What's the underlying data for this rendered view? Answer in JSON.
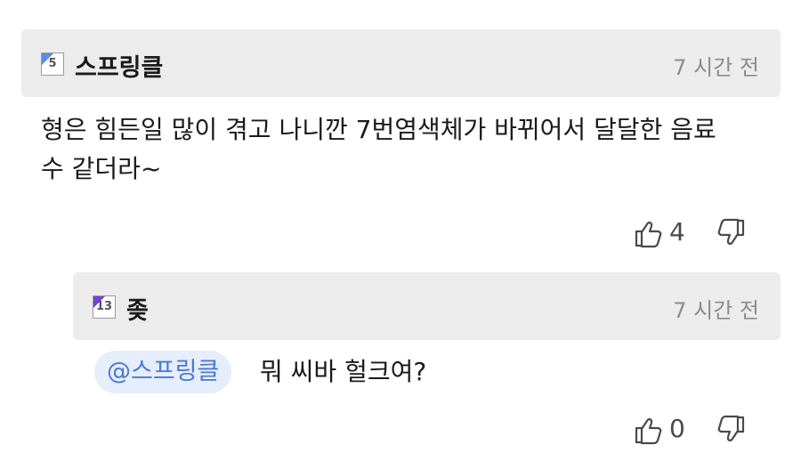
{
  "comments": [
    {
      "author": "스프링클",
      "level": "5",
      "time": "7 시간 전",
      "text_line1": "형은 힘든일 많이 겪고 나니깐 7번염색체가 바뀌어서 달달한 음료",
      "text_line2": "수 같더라~",
      "likes": "4",
      "badge_color": "#5b8ee0"
    },
    {
      "author": "좆",
      "level": "13",
      "time": "7 시간 전",
      "mention": "@스프링클",
      "text": "뭐 씨바 헐크여?",
      "likes": "0",
      "badge_color": "#7a3fd8"
    }
  ],
  "icons": {
    "like": "thumbs-up-icon",
    "dislike": "thumbs-down-icon"
  }
}
